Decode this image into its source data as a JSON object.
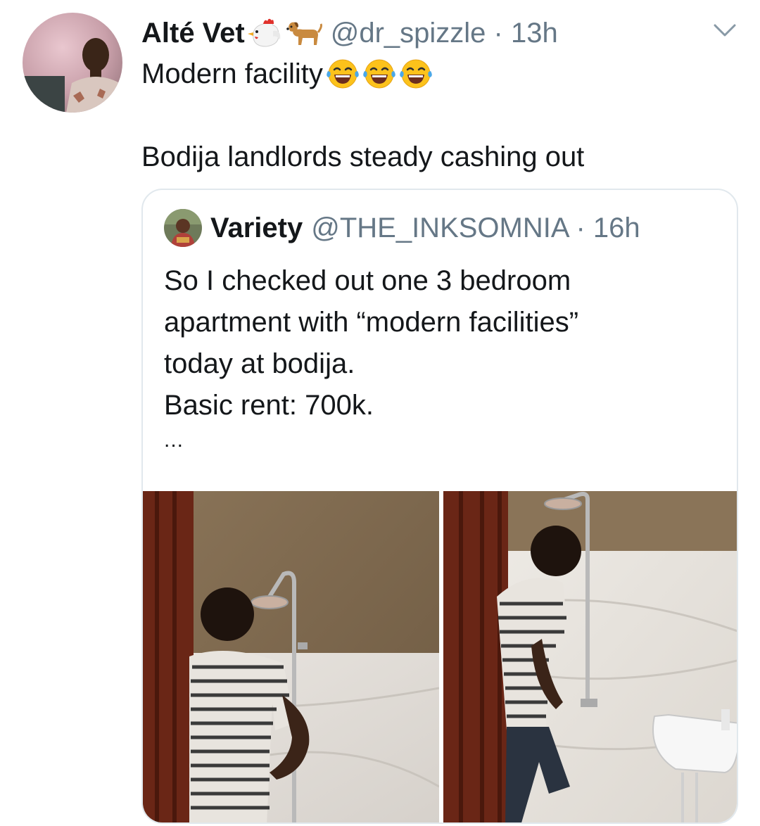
{
  "tweet": {
    "author_name": "Alté Vet",
    "author_handle": "@dr_spizzle",
    "time_separator": "·",
    "time": "13h",
    "text_line1": "Modern facility",
    "text_line2": "Bodija landlords steady cashing out"
  },
  "quoted_tweet": {
    "author_name": "Variety",
    "author_handle": "@THE_INKSOMNIA",
    "time_separator": "·",
    "time": "16h",
    "lines": [
      "So I checked out one 3 bedroom",
      "apartment with “modern facilities”",
      "today at bodija.",
      "Basic rent: 700k."
    ],
    "ellipsis": "...",
    "media": [
      {
        "icon": "shower-photo-1"
      },
      {
        "icon": "shower-photo-2"
      }
    ]
  },
  "colors": {
    "text": "#14171a",
    "secondary": "#657786",
    "border": "#e1e8ed"
  }
}
